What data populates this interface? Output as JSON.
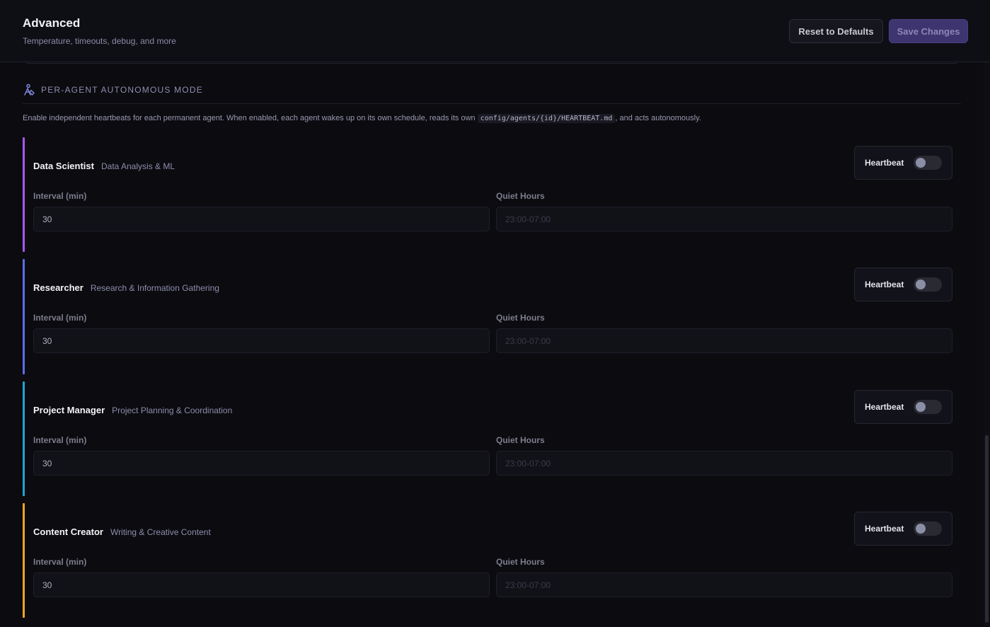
{
  "header": {
    "title": "Advanced",
    "subtitle": "Temperature, timeouts, debug, and more",
    "reset_label": "Reset to Defaults",
    "save_label": "Save Changes"
  },
  "section": {
    "icon": "agent-autonomy-icon",
    "title": "PER-AGENT AUTONOMOUS MODE",
    "desc_before": "Enable independent heartbeats for each permanent agent. When enabled, each agent wakes up on its own schedule, reads its own ",
    "desc_code": "config/agents/{id}/HEARTBEAT.md",
    "desc_after": ", and acts autonomously."
  },
  "agents": [
    {
      "name": "Data Scientist",
      "role": "Data Analysis & ML",
      "accent": "#a855f7",
      "heartbeat_label": "Heartbeat",
      "heartbeat_enabled": false,
      "interval_label": "Interval (min)",
      "interval_value": "30",
      "quiet_label": "Quiet Hours",
      "quiet_placeholder": "23:00-07:00"
    },
    {
      "name": "Researcher",
      "role": "Research & Information Gathering",
      "accent": "#5b6ee8",
      "heartbeat_label": "Heartbeat",
      "heartbeat_enabled": false,
      "interval_label": "Interval (min)",
      "interval_value": "30",
      "quiet_label": "Quiet Hours",
      "quiet_placeholder": "23:00-07:00"
    },
    {
      "name": "Project Manager",
      "role": "Project Planning & Coordination",
      "accent": "#1ea5d6",
      "heartbeat_label": "Heartbeat",
      "heartbeat_enabled": false,
      "interval_label": "Interval (min)",
      "interval_value": "30",
      "quiet_label": "Quiet Hours",
      "quiet_placeholder": "23:00-07:00"
    },
    {
      "name": "Content Creator",
      "role": "Writing & Creative Content",
      "accent": "#f5a524",
      "heartbeat_label": "Heartbeat",
      "heartbeat_enabled": false,
      "interval_label": "Interval (min)",
      "interval_value": "30",
      "quiet_label": "Quiet Hours",
      "quiet_placeholder": "23:00-07:00"
    }
  ]
}
